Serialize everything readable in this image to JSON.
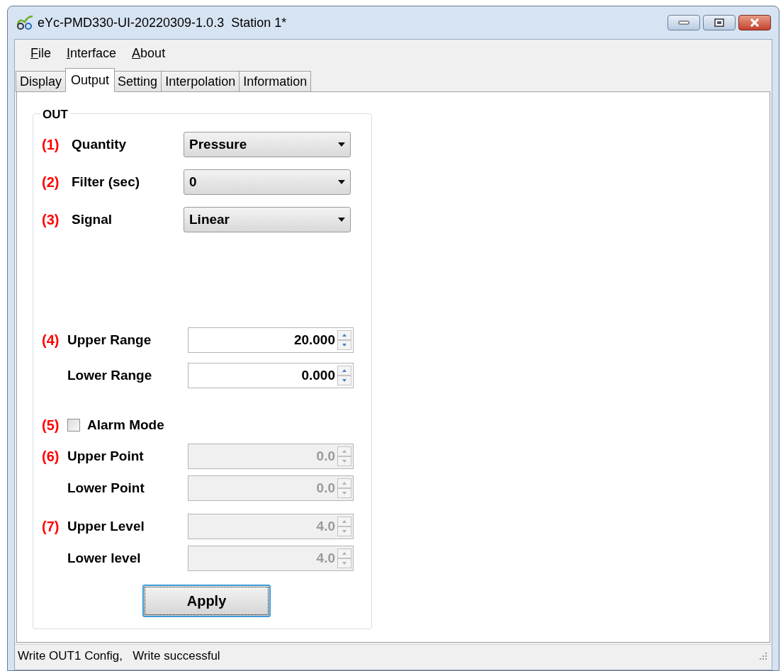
{
  "window": {
    "title": "eYc-PMD330-UI-20220309-1.0.3  Station 1*"
  },
  "menu": [
    {
      "label": "File",
      "mnemonic": true
    },
    {
      "label": "Interface",
      "mnemonic": true
    },
    {
      "label": "About",
      "mnemonic": true
    }
  ],
  "tabs": [
    {
      "label": "Display",
      "selected": false
    },
    {
      "label": "Output",
      "selected": true
    },
    {
      "label": "Setting",
      "selected": false
    },
    {
      "label": "Interpolation",
      "selected": false
    },
    {
      "label": "Information",
      "selected": false
    }
  ],
  "group": {
    "title": "OUT",
    "sections": [
      [
        {
          "kind": "select",
          "annotation": "(1)",
          "label": "Quantity",
          "value": "Pressure"
        },
        {
          "kind": "select",
          "annotation": "(2)",
          "label": "Filter (sec)",
          "value": "0"
        },
        {
          "kind": "select",
          "annotation": "(3)",
          "label": "Signal",
          "value": "Linear"
        }
      ],
      [
        {
          "kind": "spin",
          "annotation": "(4)",
          "label": "Upper Range",
          "value": "20.000",
          "disabled": false
        },
        {
          "kind": "spin",
          "label": "Lower Range",
          "value": "0.000",
          "disabled": false
        }
      ],
      [
        {
          "kind": "checkbox",
          "annotation": "(5)",
          "label": "Alarm Mode",
          "checked": false
        }
      ],
      [
        {
          "kind": "spin",
          "annotation": "(6)",
          "label": "Upper Point",
          "value": "0.0",
          "disabled": true
        },
        {
          "kind": "spin",
          "label": "Lower Point",
          "value": "0.0",
          "disabled": true
        }
      ],
      [
        {
          "kind": "spin",
          "annotation": "(7)",
          "label": "Upper Level",
          "value": "4.0",
          "disabled": true
        },
        {
          "kind": "spin",
          "label": "Lower level",
          "value": "4.0",
          "disabled": true
        }
      ]
    ],
    "apply_button": "Apply"
  },
  "status_bar": "Write OUT1 Config,   Write successful"
}
